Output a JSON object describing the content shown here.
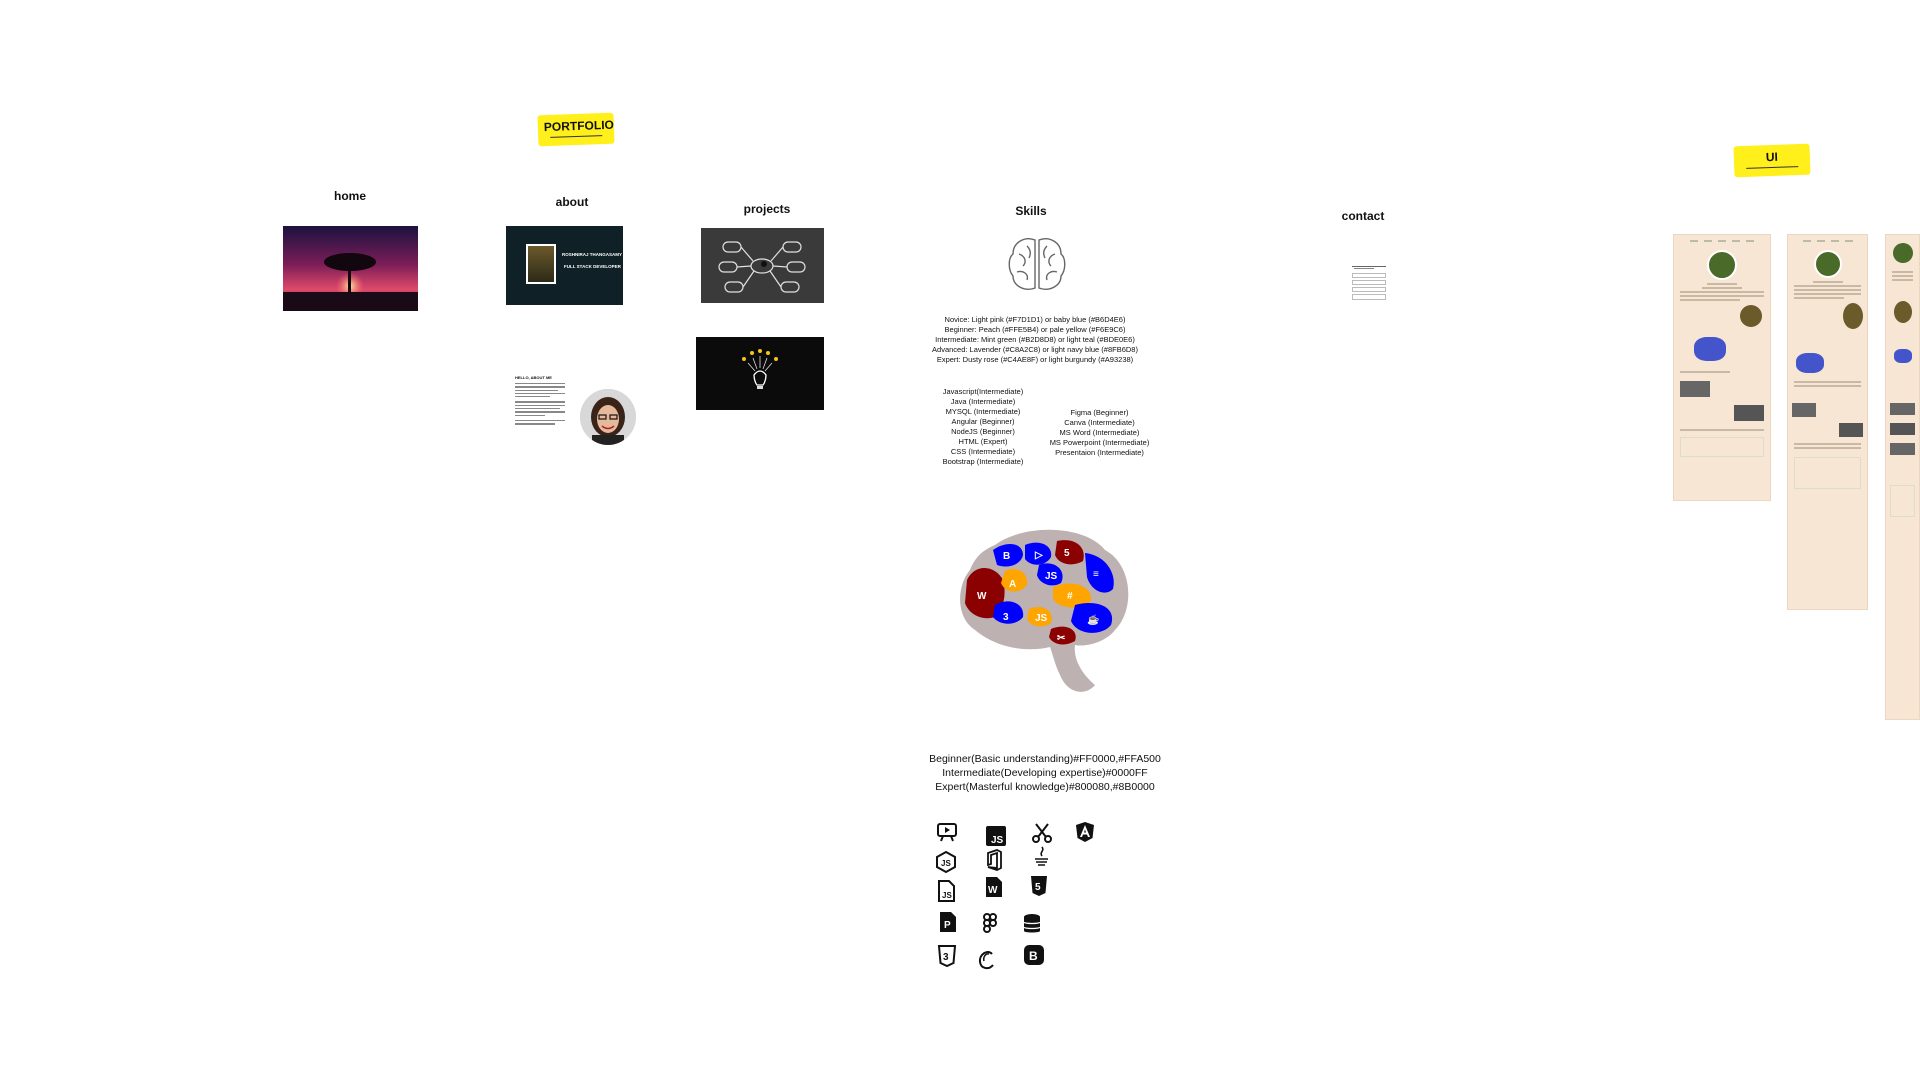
{
  "tags": {
    "portfolio": "PORTFOLIO",
    "ui": "UI"
  },
  "headings": {
    "home": "home",
    "about": "about",
    "projects": "projects",
    "skills": "Skills",
    "contact": "contact"
  },
  "about_card": {
    "name": "ROSHNIRAJ THANGASAMY",
    "role": "FULL STACK DEVELOPER"
  },
  "about_text": {
    "title": "HELLO, ABOUT ME"
  },
  "skill_levels": [
    "Novice: Light pink (#F7D1D1) or baby blue (#B6D4E6)",
    "Beginner: Peach (#FFE5B4) or pale yellow (#F6E9C6)",
    "Intermediate: Mint green (#B2D8D8) or light teal (#BDE0E6)",
    "Advanced: Lavender (#C8A2C8) or light navy blue (#8FB6D8)",
    "Expert: Dusty rose (#C4AE8F) or light burgundy (#A93238)"
  ],
  "tech_skills": [
    "Javascript(Intermediate)",
    "Java    (Intermediate)",
    "MYSQL    (Intermediate)",
    "Angular    (Beginner)",
    "NodeJS    (Beginner)",
    "HTML     (Expert)",
    "CSS      (Intermediate)",
    "Bootstrap   (Intermediate)"
  ],
  "tool_skills": [
    "Figma        (Beginner)",
    "Canva        (Intermediate)",
    "MS Word      (Intermediate)",
    "MS Powerpoint  (Intermediate)",
    "Presentaion  (Intermediate)"
  ],
  "brain_legend": [
    "Beginner(Basic understanding)#FF0000,#FFA500",
    "Intermediate(Developing expertise)#0000FF",
    "Expert(Masterful knowledge)#800080,#8B0000"
  ],
  "colors": {
    "highlight": "#ffef1a",
    "blue": "#0000FF",
    "orange": "#FFA500",
    "darkred": "#8B0000",
    "grey": "#bdb1b1",
    "ui_bg": "#f8e6d4"
  },
  "icons": [
    "presentation-icon",
    "js-file-icon",
    "scissors-icon",
    "angular-icon",
    "nodejs-icon",
    "office-icon",
    "java-icon",
    "js-doc-icon",
    "word-icon",
    "html5-icon",
    "powerpoint-icon",
    "figma-icon",
    "database-icon",
    "css3-icon",
    "canva-icon",
    "bootstrap-icon"
  ]
}
